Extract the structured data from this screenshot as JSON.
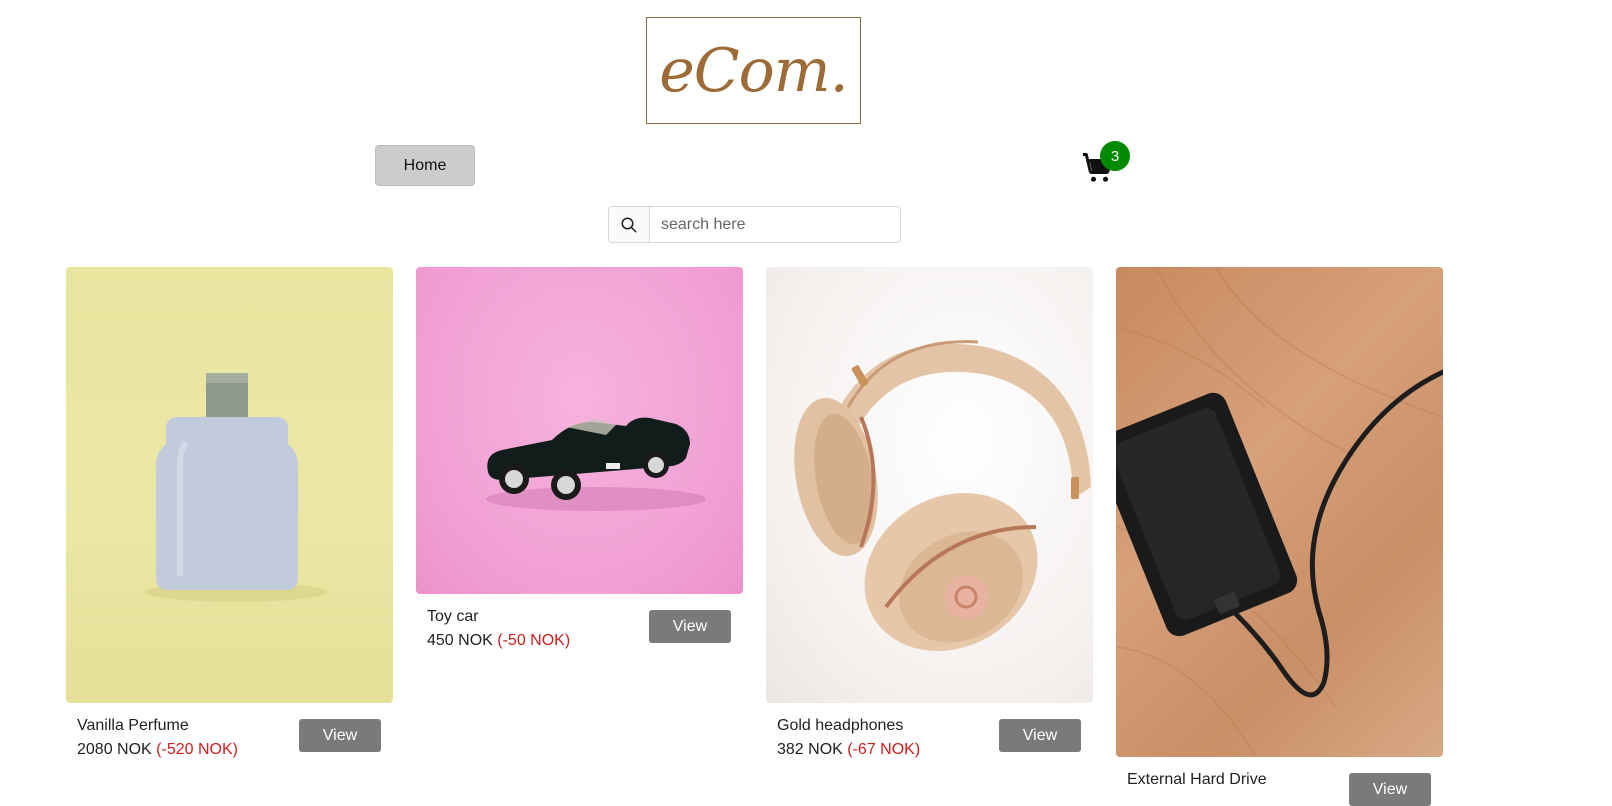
{
  "header": {
    "logo_text": "eCom."
  },
  "nav": {
    "home_label": "Home"
  },
  "cart": {
    "count": "3"
  },
  "search": {
    "placeholder": "search here"
  },
  "products": [
    {
      "name": "Vanilla Perfume",
      "price": "2080 NOK",
      "discount": "(-520 NOK)",
      "view_label": "View"
    },
    {
      "name": "Toy car",
      "price": "450 NOK",
      "discount": "(-50 NOK)",
      "view_label": "View"
    },
    {
      "name": "Gold headphones",
      "price": "382 NOK",
      "discount": "(-67 NOK)",
      "view_label": "View"
    },
    {
      "name": "External Hard Drive",
      "price": "",
      "discount": "",
      "view_label": "View"
    }
  ],
  "colors": {
    "accent_logo": "#9c6b38",
    "badge": "#008a00",
    "discount": "#cc1f1f",
    "view_button": "#7a7a7a"
  }
}
